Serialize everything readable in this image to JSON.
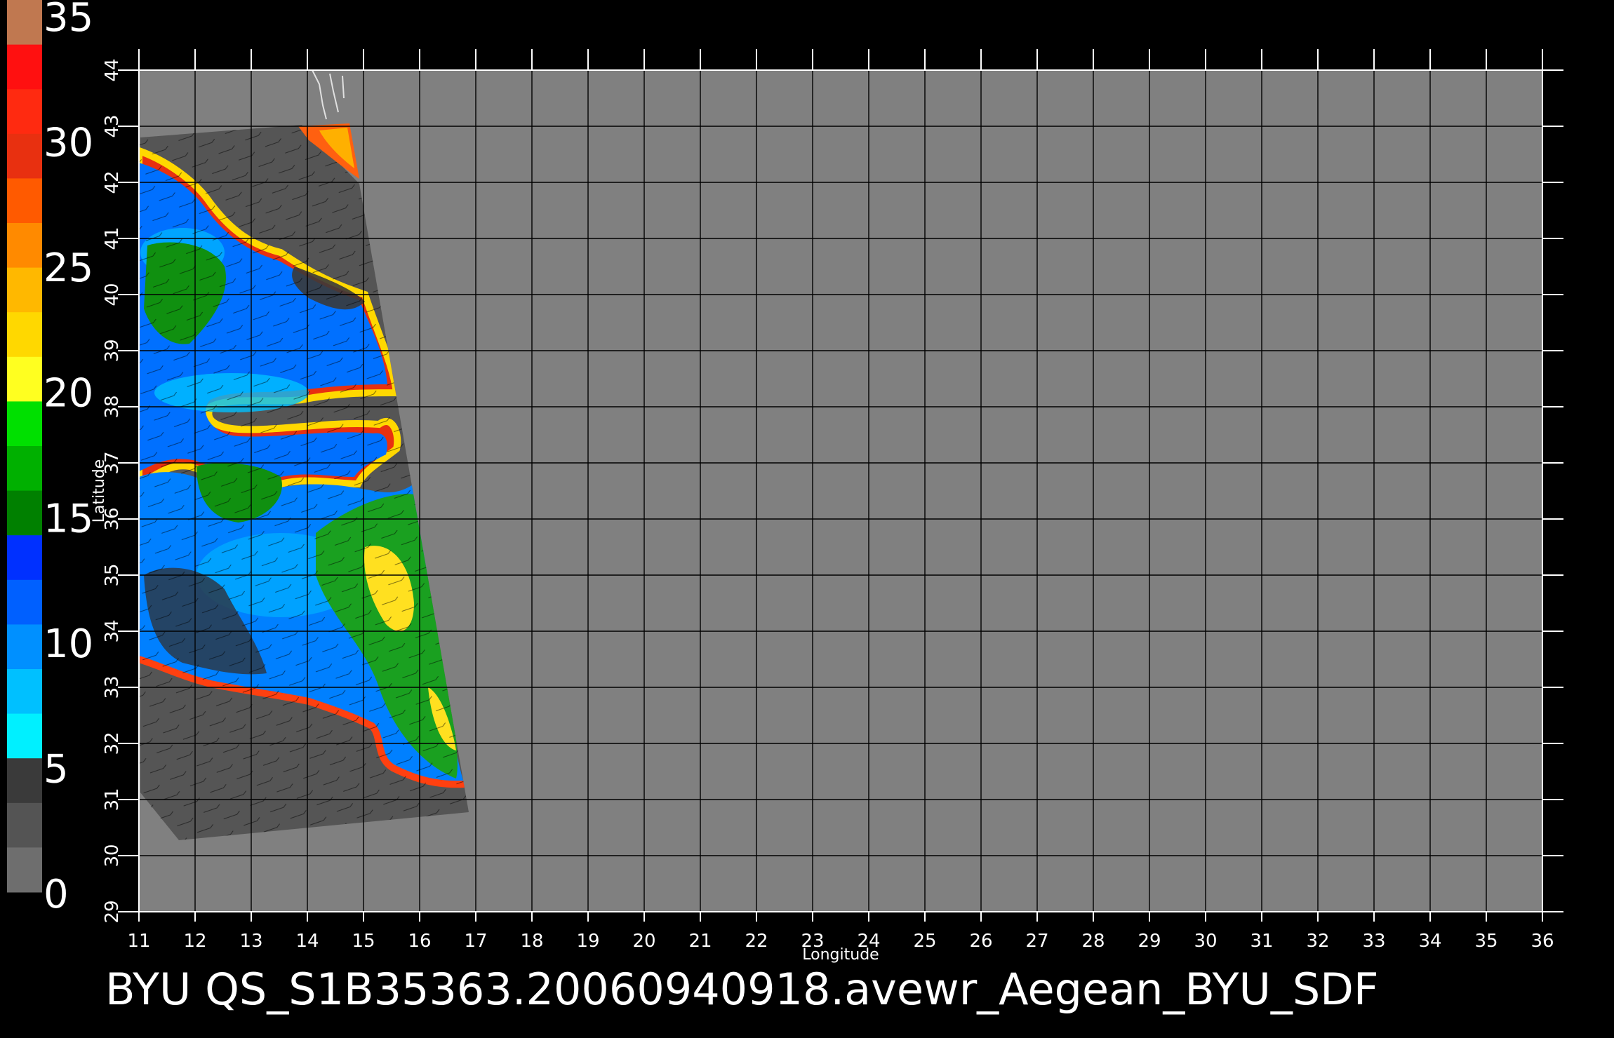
{
  "colorbar": {
    "ticks": [
      "35",
      "30",
      "25",
      "20",
      "15",
      "10",
      "5",
      "0"
    ],
    "segments": [
      {
        "color": "#c07850"
      },
      {
        "color": "#ff1010"
      },
      {
        "color": "#ff2a10"
      },
      {
        "color": "#e83010"
      },
      {
        "color": "#ff5a00"
      },
      {
        "color": "#ff8a00"
      },
      {
        "color": "#ffb800"
      },
      {
        "color": "#ffd800"
      },
      {
        "color": "#ffff20"
      },
      {
        "color": "#00e000"
      },
      {
        "color": "#00b000"
      },
      {
        "color": "#008000"
      },
      {
        "color": "#0030ff"
      },
      {
        "color": "#0060ff"
      },
      {
        "color": "#0090ff"
      },
      {
        "color": "#00c0ff"
      },
      {
        "color": "#00f0ff"
      },
      {
        "color": "#3a3a3a"
      },
      {
        "color": "#545454"
      },
      {
        "color": "#6e6e6e"
      }
    ]
  },
  "map": {
    "xlabel": "Longitude",
    "ylabel": "Latitude",
    "lon_ticks": [
      "11",
      "12",
      "13",
      "14",
      "15",
      "16",
      "17",
      "18",
      "19",
      "20",
      "21",
      "22",
      "23",
      "24",
      "25",
      "26",
      "27",
      "28",
      "29",
      "30",
      "31",
      "32",
      "33",
      "34",
      "35",
      "36"
    ],
    "lat_ticks": [
      "29",
      "30",
      "31",
      "32",
      "33",
      "34",
      "35",
      "36",
      "37",
      "38",
      "39",
      "40",
      "41",
      "42",
      "43",
      "44"
    ],
    "background_color": "#808080",
    "swath_color": "#555555",
    "grid_color": "#000000"
  },
  "footer": {
    "title": "BYU  QS_S1B35363.20060940918.avewr_Aegean_BYU_SDF"
  }
}
